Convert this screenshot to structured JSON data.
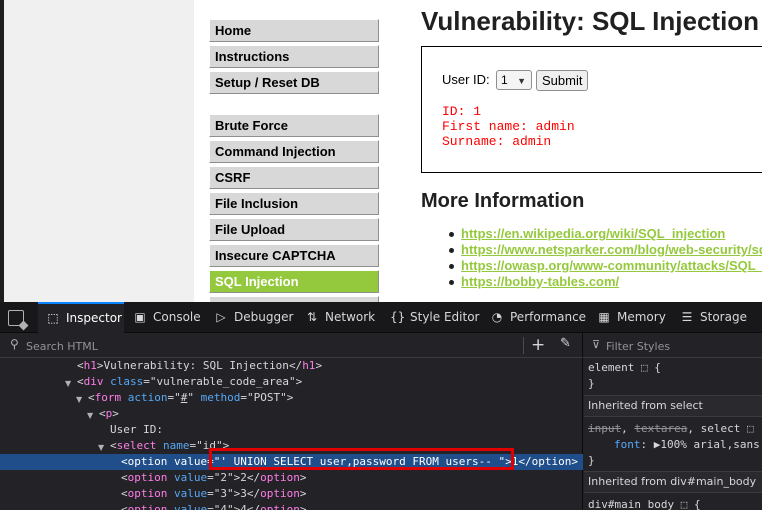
{
  "page": {
    "menu": [
      {
        "label": "Home"
      },
      {
        "label": "Instructions"
      },
      {
        "label": "Setup / Reset DB"
      },
      {
        "label": "Brute Force"
      },
      {
        "label": "Command Injection"
      },
      {
        "label": "CSRF"
      },
      {
        "label": "File Inclusion"
      },
      {
        "label": "File Upload"
      },
      {
        "label": "Insecure CAPTCHA"
      },
      {
        "label": "SQL Injection",
        "active": true
      }
    ],
    "title": "Vulnerability: SQL Injection",
    "form": {
      "user_id_label": "User ID:",
      "select_value": "1",
      "submit_label": "Submit"
    },
    "result": {
      "id_line": "ID: 1",
      "first_name_line": "First name: admin",
      "surname_line": "Surname: admin"
    },
    "more_info_heading": "More Information",
    "links": [
      "https://en.wikipedia.org/wiki/SQL_injection",
      "https://www.netsparker.com/blog/web-security/sql-injection-cheat-sheet/",
      "https://owasp.org/www-community/attacks/SQL_Injection",
      "https://bobby-tables.com/"
    ],
    "accent_color": "#95c93d",
    "result_color": "#ff0000"
  },
  "devtools": {
    "tabs": [
      {
        "label": "Inspector",
        "icon": "inspector-icon",
        "active": true
      },
      {
        "label": "Console",
        "icon": "console-icon"
      },
      {
        "label": "Debugger",
        "icon": "debugger-icon"
      },
      {
        "label": "Network",
        "icon": "network-icon"
      },
      {
        "label": "Style Editor",
        "icon": "style-editor-icon"
      },
      {
        "label": "Performance",
        "icon": "performance-icon"
      },
      {
        "label": "Memory",
        "icon": "memory-icon"
      },
      {
        "label": "Storage",
        "icon": "storage-icon"
      }
    ],
    "search_placeholder": "Search HTML",
    "filter_placeholder": "Filter Styles",
    "markup": {
      "h1_text": "Vulnerability: SQL Injection",
      "div_class": "vulnerable_code_area",
      "form_action": "#",
      "form_method": "POST",
      "p_text": "User ID:",
      "select_name": "id",
      "selected_option_value": "' UNION SELECT user,password FROM users-- ",
      "selected_option_text": "1",
      "options": [
        {
          "value": "2",
          "text": "2"
        },
        {
          "value": "3",
          "text": "3"
        },
        {
          "value": "4",
          "text": "4"
        }
      ]
    },
    "rules": {
      "element_selector": "element",
      "inherited_select_label": "Inherited from select",
      "inherited_selector_input": "input",
      "inherited_selector_textarea": "textarea",
      "inherited_selector_select": "select",
      "font_prop": "font",
      "font_value": "100% arial,sans",
      "inherited_body_label": "Inherited from div#main_body",
      "body_selector": "div#main_body"
    },
    "selection_color": "#204e8a",
    "highlight_color": "#e00000"
  }
}
